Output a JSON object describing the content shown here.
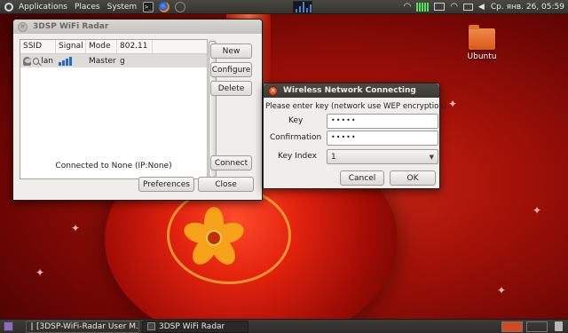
{
  "top_panel": {
    "menus": [
      "Applications",
      "Places",
      "System"
    ],
    "clock": "Ср. янв. 26, 05:59"
  },
  "desktop": {
    "icons": [
      {
        "label": "Ubuntu",
        "icon": "folder-icon"
      }
    ]
  },
  "radar_window": {
    "title": "3DSP WiFi Radar",
    "columns": [
      "SSID",
      "Signal",
      "Mode",
      "802.11"
    ],
    "rows": [
      {
        "ssid": "lan",
        "signal_level": 0.75,
        "mode": "Master",
        "standard": "g"
      }
    ],
    "buttons": {
      "new": "New",
      "configure": "Configure",
      "delete": "Delete",
      "connect": "Connect",
      "preferences": "Preferences",
      "close": "Close"
    },
    "status": "Connected to None (IP:None)"
  },
  "connect_dialog": {
    "title": "Wireless Network Connecting",
    "prompt": "Please enter key (network use WEP encryption)",
    "key_label": "Key",
    "key_value": "•••••",
    "confirmation_label": "Confirmation",
    "confirmation_value": "•••••",
    "key_index_label": "Key Index",
    "key_index_value": "1",
    "cancel": "Cancel",
    "ok": "OK"
  },
  "bottom_panel": {
    "tasks": [
      {
        "label": "[3DSP-WiFi-Radar User M..."
      },
      {
        "label": "3DSP WiFi Radar"
      }
    ]
  },
  "colors": {
    "wallpaper": "#a51208",
    "panel": "#3a3934",
    "accent_close": "#d9481e",
    "signal": "#2a66c8"
  }
}
